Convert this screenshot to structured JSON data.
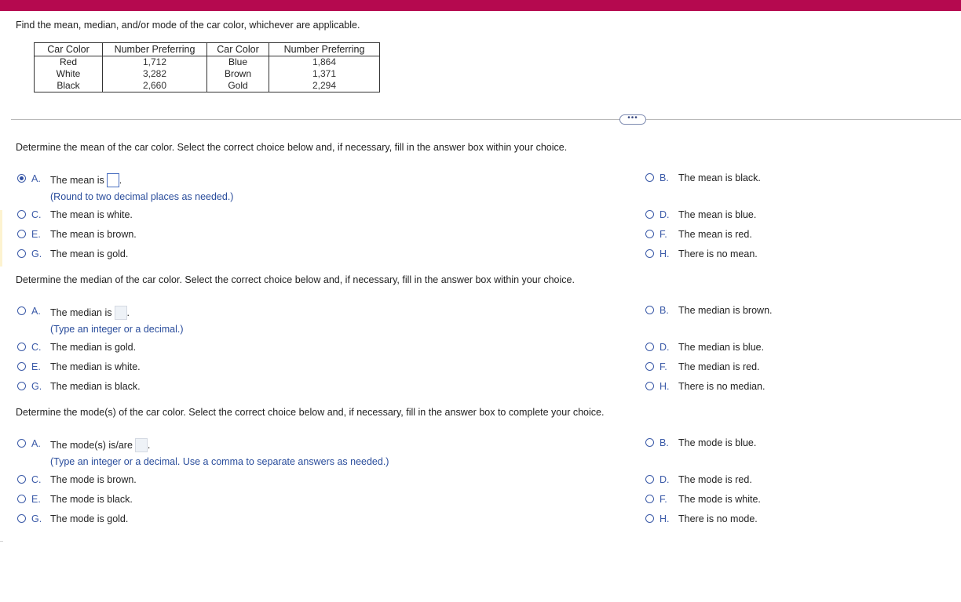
{
  "prompt": "Find the mean, median, and/or mode of the car color, whichever are applicable.",
  "table": {
    "headers": [
      "Car Color",
      "Number Preferring",
      "Car Color",
      "Number Preferring"
    ],
    "rows": [
      [
        "Red",
        "1,712",
        "Blue",
        "1,864"
      ],
      [
        "White",
        "3,282",
        "Brown",
        "1,371"
      ],
      [
        "Black",
        "2,660",
        "Gold",
        "2,294"
      ]
    ]
  },
  "more_label": "•••",
  "questions": [
    {
      "prompt": "Determine the mean of the car color. Select the correct choice below and, if necessary, fill in the answer box within your choice.",
      "options": [
        {
          "letter": "A.",
          "text": "The mean is",
          "hint": "(Round to two decimal places as needed.)",
          "selected": true
        },
        {
          "letter": "B.",
          "text": "The mean is black."
        },
        {
          "letter": "C.",
          "text": "The mean is white."
        },
        {
          "letter": "D.",
          "text": "The mean is blue."
        },
        {
          "letter": "E.",
          "text": "The mean is brown."
        },
        {
          "letter": "F.",
          "text": "The mean is red."
        },
        {
          "letter": "G.",
          "text": "The mean is gold."
        },
        {
          "letter": "H.",
          "text": "There is no mean."
        }
      ]
    },
    {
      "prompt": "Determine the median of the car color. Select the correct choice below and, if necessary, fill in the answer box within your choice.",
      "options": [
        {
          "letter": "A.",
          "text": "The median is",
          "hint": "(Type an integer or a decimal.)",
          "selected": false
        },
        {
          "letter": "B.",
          "text": "The median is brown."
        },
        {
          "letter": "C.",
          "text": "The median is gold."
        },
        {
          "letter": "D.",
          "text": "The median is blue."
        },
        {
          "letter": "E.",
          "text": "The median is white."
        },
        {
          "letter": "F.",
          "text": "The median is red."
        },
        {
          "letter": "G.",
          "text": "The median is black."
        },
        {
          "letter": "H.",
          "text": "There is no median."
        }
      ]
    },
    {
      "prompt": "Determine the mode(s) of the car color. Select the correct choice below and, if necessary, fill in the answer box to complete your choice.",
      "options": [
        {
          "letter": "A.",
          "text": "The mode(s) is/are",
          "hint": "(Type an integer or a decimal. Use a comma to separate answers as needed.)",
          "selected": false
        },
        {
          "letter": "B.",
          "text": "The mode is blue."
        },
        {
          "letter": "C.",
          "text": "The mode is brown."
        },
        {
          "letter": "D.",
          "text": "The mode is red."
        },
        {
          "letter": "E.",
          "text": "The mode is black."
        },
        {
          "letter": "F.",
          "text": "The mode is white."
        },
        {
          "letter": "G.",
          "text": "The mode is gold."
        },
        {
          "letter": "H.",
          "text": "There is no mode."
        }
      ]
    }
  ],
  "colors": {
    "accent_bar": "#b5094f",
    "option_letter": "#3b5aa8",
    "hint": "#2a4d9c"
  }
}
